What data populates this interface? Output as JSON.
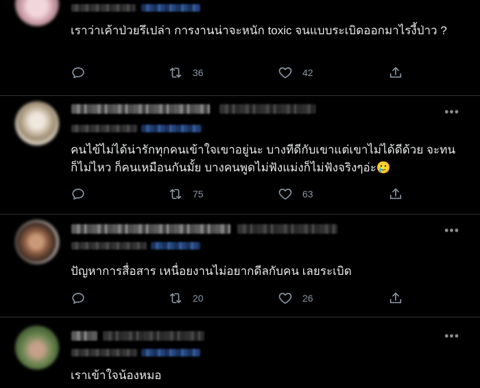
{
  "tweets": [
    {
      "text": "เราว่าเค้าป่วยรึเปล่า การงานน่าจะหนัก toxic จนแบบระเบิดออกมาไรงี้ป่าว ?",
      "retweets": "36",
      "likes": "42"
    },
    {
      "text": "คนไข้ไม่ได้น่ารักทุกคนเข้าใจเขาอยู่นะ บางทีดีกับเขาแต่เขาไม่ได้ดีด้วย จะทนก็ไม่ไหว ก็คนเหมือนกันมั้ย บางคนพูดไม่ฟังแม่งก็ไม่ฟังจริงๆอ่ะ🥲",
      "retweets": "75",
      "likes": "63"
    },
    {
      "text": "ปัญหาการสื่อสาร เหนื่อยงานไม่อยากดีลกับคน เลยระเบิด",
      "retweets": "20",
      "likes": "26"
    },
    {
      "text": "เราเข้าใจน้องหมอ"
    }
  ],
  "icons": {
    "reply": "reply-icon",
    "retweet": "retweet-icon",
    "like": "heart-icon",
    "share": "share-icon",
    "more": "more-icon"
  },
  "colors": {
    "background": "#000000",
    "text": "#e7e9ea",
    "muted": "#8b98a5",
    "divider": "#2f3336"
  }
}
